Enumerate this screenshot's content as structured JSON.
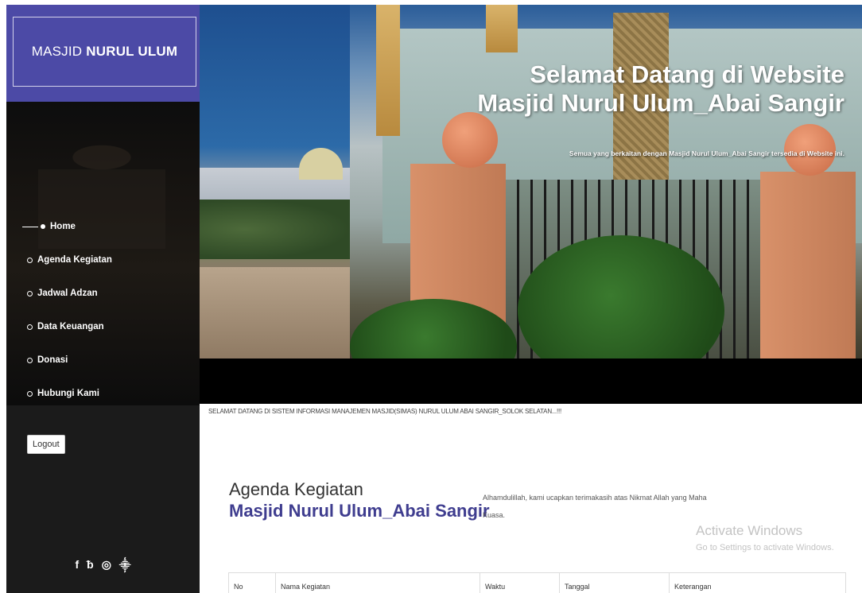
{
  "sidebar": {
    "brand_light": "MASJID",
    "brand_bold": "NURUL ULUM",
    "brand_color": "#4c4aa6",
    "menu": [
      {
        "label": "Home",
        "active": true
      },
      {
        "label": "Agenda Kegiatan",
        "active": false
      },
      {
        "label": "Jadwal Adzan",
        "active": false
      },
      {
        "label": "Data Keuangan",
        "active": false
      },
      {
        "label": "Donasi",
        "active": false
      },
      {
        "label": "Hubungi Kami",
        "active": false
      }
    ],
    "logout_label": "Logout",
    "socials": [
      {
        "icon": "facebook-icon",
        "glyph": "f"
      },
      {
        "icon": "twitter-icon",
        "glyph": "🐦"
      },
      {
        "icon": "instagram-icon",
        "glyph": "◎"
      },
      {
        "icon": "rss-icon",
        "glyph": "⟫"
      }
    ]
  },
  "hero": {
    "title_line1": "Selamat Datang di Website",
    "title_line2": "Masjid Nurul Ulum_Abai Sangir",
    "subtitle": "Semua yang berkaitan dengan Masjid Nurul Ulum_Abai Sangir tersedia di Website ini."
  },
  "main": {
    "marquee": "SELAMAT DATANG DI SISTEM INFORMASI MANAJEMEN MASJID(SIMAS) NURUL ULUM ABAI SANGIR_SOLOK SELATAN...!!!",
    "section_title_line1": "Agenda Kegiatan",
    "section_title_line2": "Masjid Nurul Ulum_Abai Sangir",
    "intro_text": "Alhamdulillah, kami ucapkan terimakasih atas Nikmat Allah yang Maha Kuasa.",
    "table_headers": [
      "No",
      "Nama Kegiatan",
      "Waktu",
      "Tanggal",
      "Keterangan"
    ]
  },
  "overlay": {
    "activate_title": "Activate Windows",
    "activate_sub": "Go to Settings to activate Windows."
  }
}
